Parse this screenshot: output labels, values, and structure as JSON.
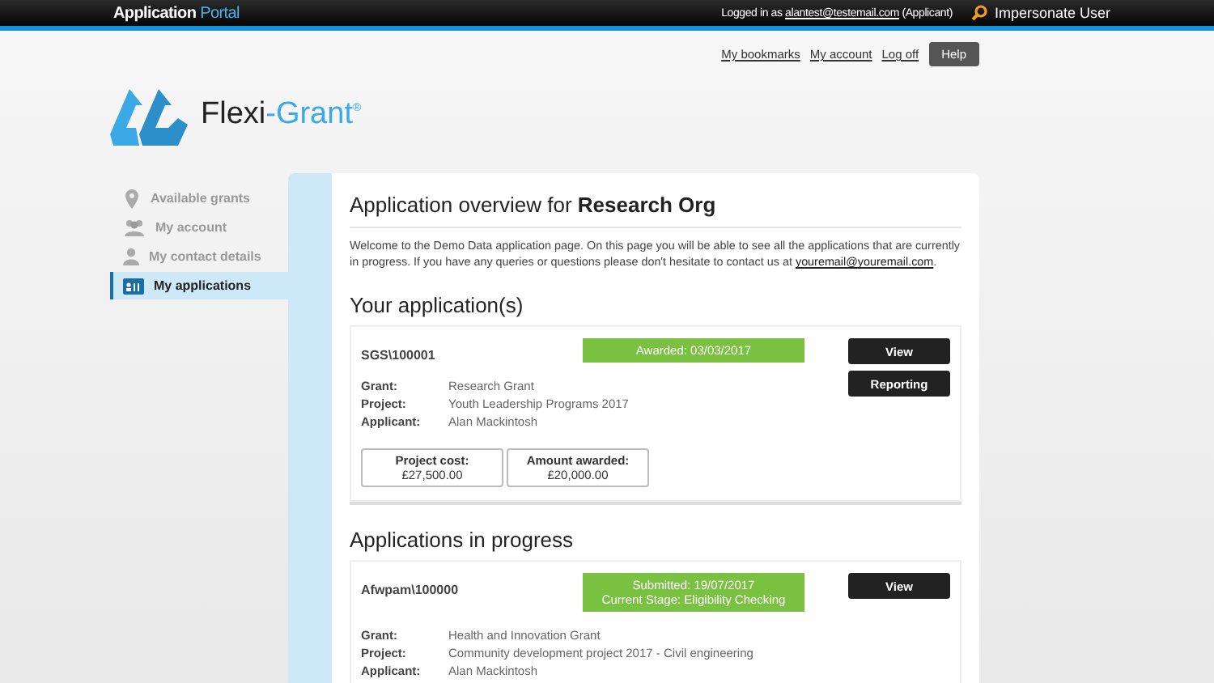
{
  "topbar": {
    "brand": "Application",
    "brand_accent": "Portal",
    "logged_in_prefix": "Logged in as",
    "user_email": "alantest@testemail.com",
    "user_role": "(Applicant)",
    "impersonate": "Impersonate User"
  },
  "top_links": [
    "My bookmarks",
    "My account",
    "Log off"
  ],
  "help_button": "Help",
  "logo": {
    "name": "Flexi",
    "accent": "-Grant",
    "mark": "®"
  },
  "sidebar": {
    "items": [
      {
        "label": "Available grants",
        "selected": false
      },
      {
        "label": "My account",
        "selected": false
      },
      {
        "label": "My contact details",
        "selected": false
      },
      {
        "label": "My applications",
        "selected": true
      }
    ]
  },
  "main": {
    "title": "Application overview for **Research Org**",
    "intro": "Welcome to the Demo Data application page. On this page you will be able to see all the applications that are currently in progress. If you have any queries or questions please don't hesitate to contact us at",
    "intro_link": "youremail@youremail.com",
    "intro_end": ".",
    "sections": [
      {
        "heading": "Your application(s)",
        "applications": [
          {
            "ref": "SGS\\100001",
            "status": [
              "Awarded: 03/03/2017"
            ],
            "buttons": [
              "View",
              "Reporting"
            ],
            "fields": [
              {
                "label": "Grant:",
                "value": "Research Grant"
              },
              {
                "label": "Project:",
                "value": "Youth Leadership Programs 2017"
              },
              {
                "label": "Applicant:",
                "value": "Alan Mackintosh"
              }
            ],
            "amounts": [
              {
                "label": "Project cost:",
                "value": "£27,500.00"
              },
              {
                "label": "Amount awarded:",
                "value": "£20,000.00"
              }
            ]
          }
        ]
      },
      {
        "heading": "Applications in progress",
        "applications": [
          {
            "ref": "Afwpam\\100000",
            "status": [
              "Submitted: 19/07/2017",
              "Current Stage: Eligibility Checking"
            ],
            "buttons": [
              "View"
            ],
            "fields": [
              {
                "label": "Grant:",
                "value": "Health and Innovation Grant"
              },
              {
                "label": "Project:",
                "value": "Community development project 2017 - Civil engineering"
              },
              {
                "label": "Applicant:",
                "value": "Alan Mackintosh"
              }
            ]
          }
        ]
      }
    ]
  }
}
